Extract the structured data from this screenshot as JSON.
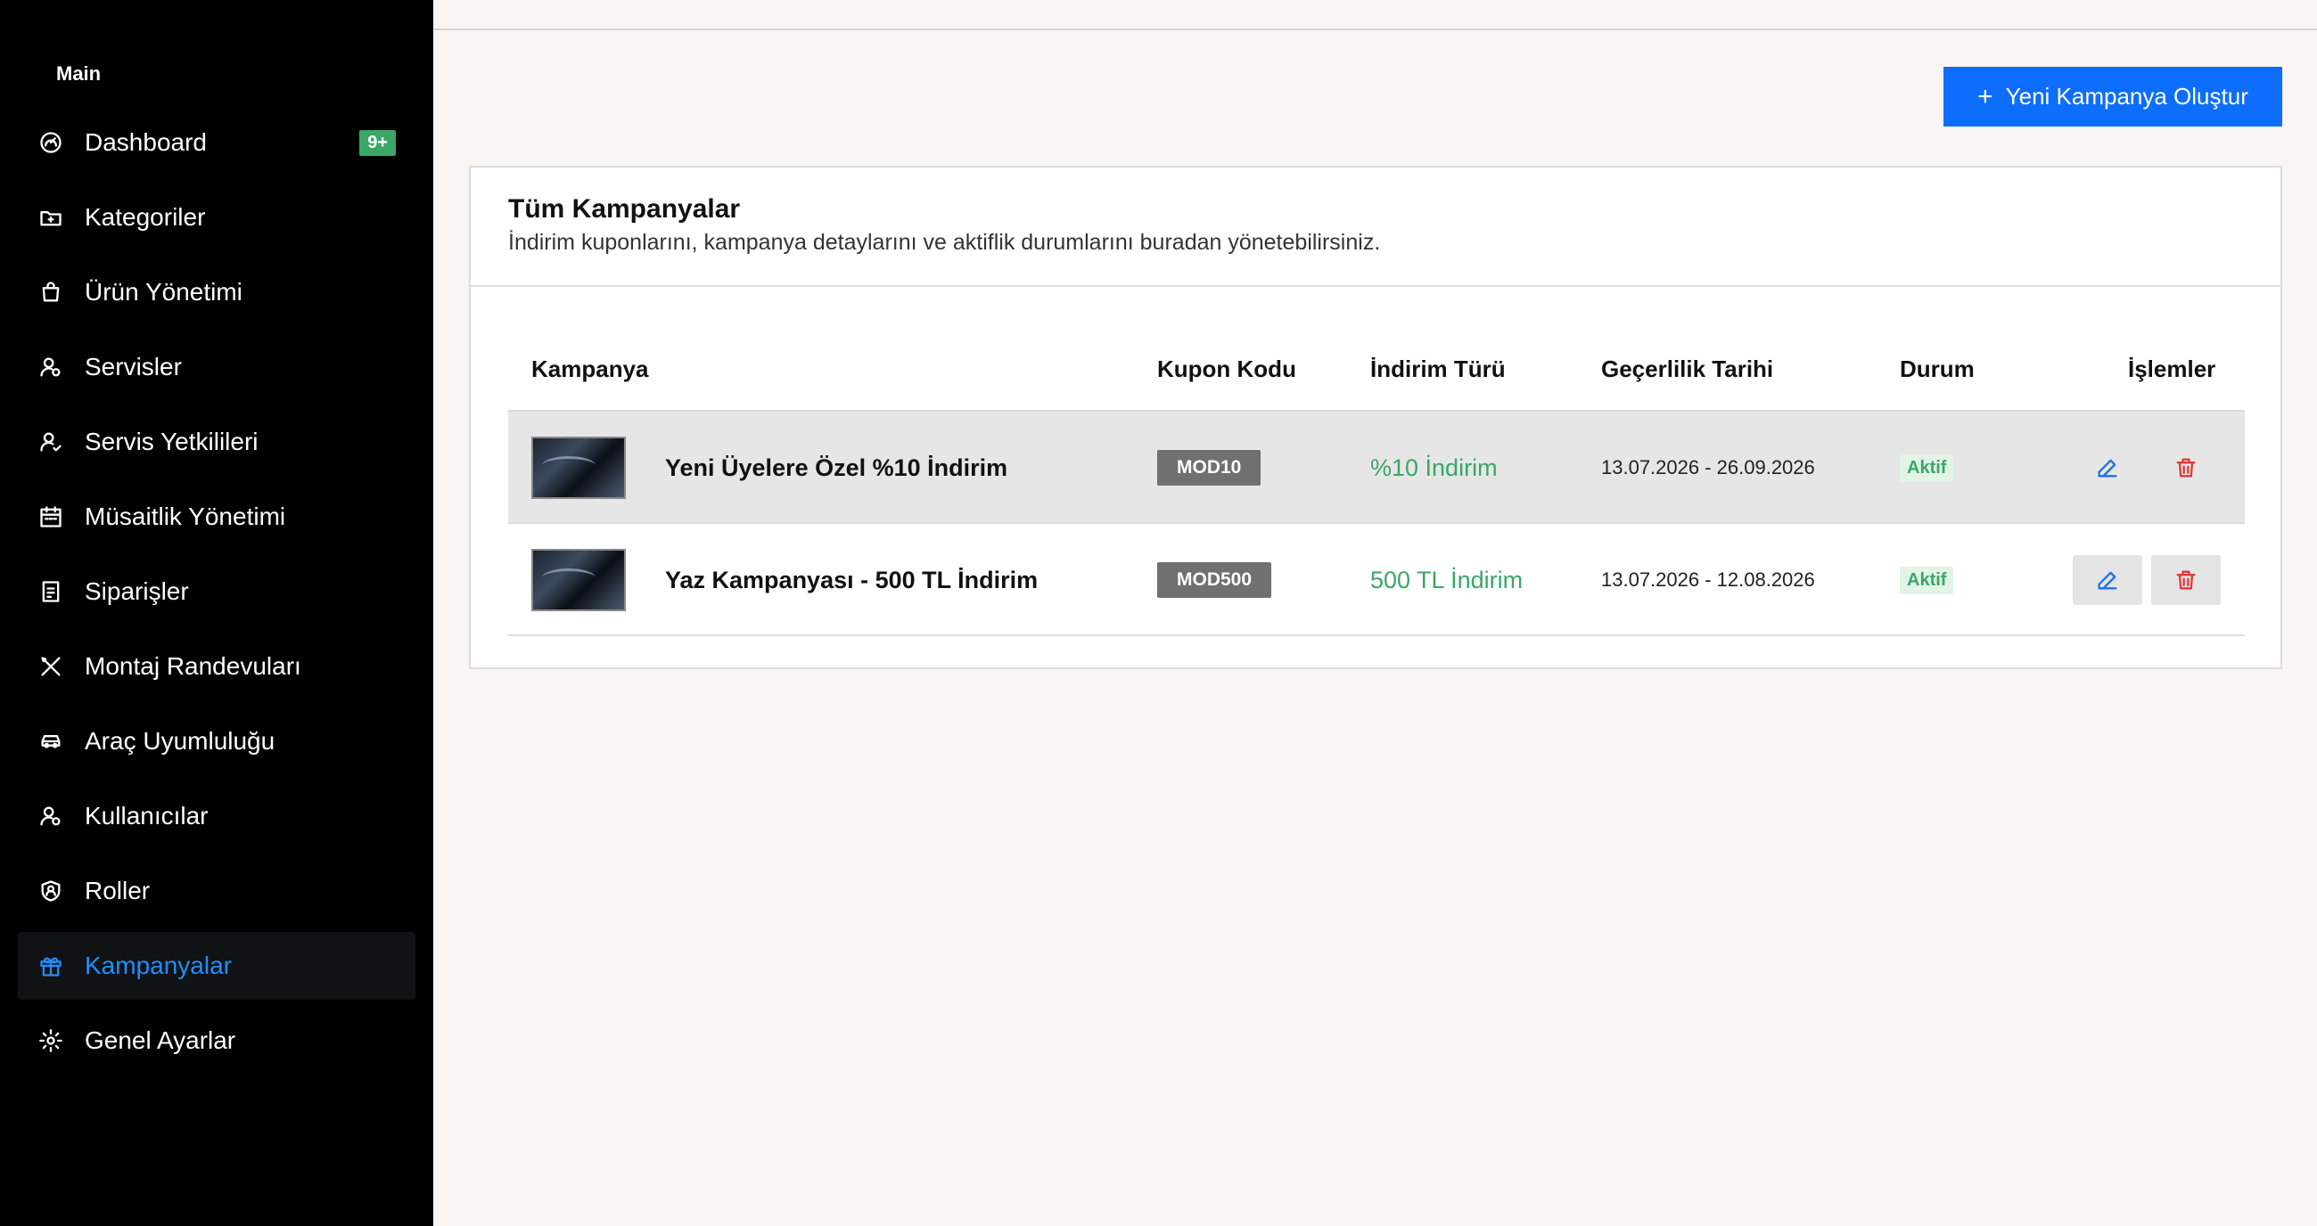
{
  "sidebar": {
    "section": "Main",
    "items": [
      {
        "label": "Dashboard",
        "icon": "gauge-icon",
        "badge": "9+"
      },
      {
        "label": "Kategoriler",
        "icon": "folder-icon"
      },
      {
        "label": "Ürün Yönetimi",
        "icon": "shopping-bag-icon"
      },
      {
        "label": "Servisler",
        "icon": "user-gear-icon"
      },
      {
        "label": "Servis Yetkilileri",
        "icon": "user-check-icon"
      },
      {
        "label": "Müsaitlik Yönetimi",
        "icon": "calendar-icon"
      },
      {
        "label": "Siparişler",
        "icon": "receipt-icon"
      },
      {
        "label": "Montaj Randevuları",
        "icon": "tools-icon"
      },
      {
        "label": "Araç Uyumluluğu",
        "icon": "car-icon"
      },
      {
        "label": "Kullanıcılar",
        "icon": "users-gear-icon"
      },
      {
        "label": "Roller",
        "icon": "shield-user-icon"
      },
      {
        "label": "Kampanyalar",
        "icon": "gift-icon",
        "active": true
      },
      {
        "label": "Genel Ayarlar",
        "icon": "gear-icon"
      }
    ]
  },
  "header": {
    "create_button": "Yeni Kampanya Oluştur"
  },
  "card": {
    "title": "Tüm Kampanyalar",
    "subtitle": "İndirim kuponlarını, kampanya detaylarını ve aktiflik durumlarını buradan yönetebilirsiniz."
  },
  "table": {
    "columns": [
      "Kampanya",
      "Kupon Kodu",
      "İndirim Türü",
      "Geçerlilik Tarihi",
      "Durum",
      "İşlemler"
    ],
    "rows": [
      {
        "name": "Yeni Üyelere Özel %10 İndirim",
        "code": "MOD10",
        "discount": "%10 İndirim",
        "validity": "13.07.2026 - 26.09.2026",
        "status": "Aktif"
      },
      {
        "name": "Yaz Kampanyası - 500 TL İndirim",
        "code": "MOD500",
        "discount": "500 TL İndirim",
        "validity": "13.07.2026 - 12.08.2026",
        "status": "Aktif"
      }
    ]
  },
  "colors": {
    "sidebar_bg": "#000000",
    "accent": "#0d6efd",
    "active_link": "#1f8fff",
    "success": "#3aa766",
    "danger": "#e03a3a"
  }
}
